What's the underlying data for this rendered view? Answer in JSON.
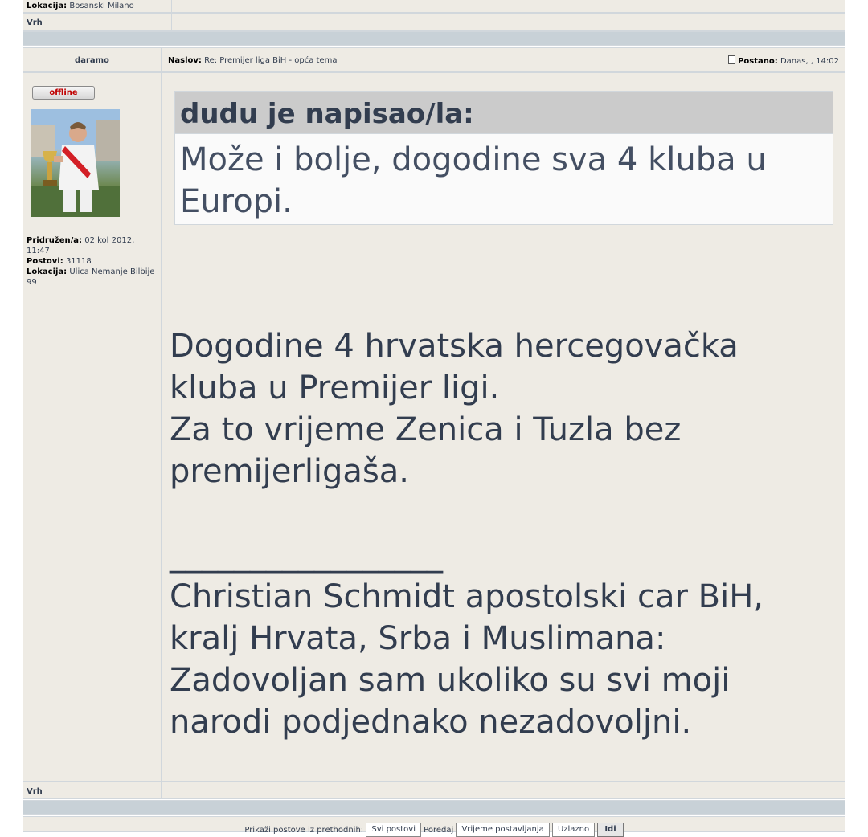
{
  "previous_post": {
    "location_label": "Lokacija:",
    "location_value": "Bosanski Milano",
    "top_link": "Vrh"
  },
  "post": {
    "author": "daramo",
    "subject_label": "Naslov:",
    "subject_value": "Re: Premijer liga BiH - opća tema",
    "posted_label": "Postano:",
    "posted_value": "Danas, , 14:02",
    "status_badge": "offline",
    "joined_label": "Pridružen/a:",
    "joined_value": "02 kol 2012, 11:47",
    "posts_label": "Postovi:",
    "posts_value": "31118",
    "location_label": "Lokacija:",
    "location_value": "Ulica Nemanje Bilbije 99",
    "quote_header": "dudu je napisao/la:",
    "quote_text": "Može i bolje, dogodine sva 4 kluba u Europi.",
    "body_line1": "Dogodine 4 hrvatska hercegovačka kluba u Premijer ligi.",
    "body_line2": "Za to vrijeme Zenica i Tuzla bez premijerligaša.",
    "signature_separator": "_________________",
    "signature": "Christian Schmidt apostolski car BiH, kralj Hrvata, Srba i Muslimana: Zadovoljan sam ukoliko su svi moji narodi podjednako nezadovoljni.",
    "top_link": "Vrh"
  },
  "footer": {
    "display_label": "Prikaži postove iz prethodnih:",
    "display_select": "Svi postovi",
    "sort_label": "Poredaj",
    "sort_select": "Vrijeme postavljanja",
    "order_select": "Uzlazno",
    "go_button": "Idi"
  },
  "colors": {
    "accent": "#006699",
    "row_bg": "#eeebe4",
    "spacer_bg": "#c8d1d7"
  }
}
